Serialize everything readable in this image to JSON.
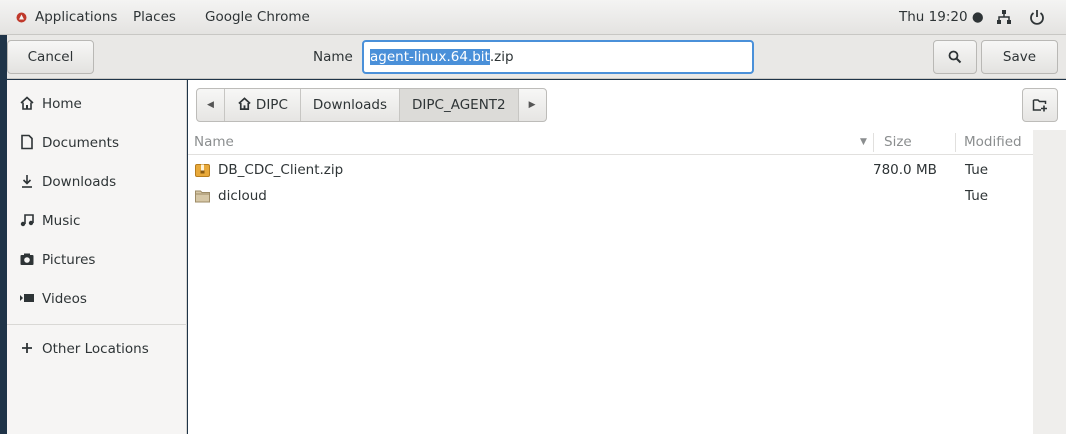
{
  "topbar": {
    "applications": "Applications",
    "places": "Places",
    "active_app": "Google Chrome",
    "clock": "Thu 19:20 ●"
  },
  "dialog": {
    "cancel": "Cancel",
    "name_label": "Name",
    "filename_selected": "agent-linux.64.bit",
    "filename_rest": ".zip",
    "save": "Save"
  },
  "sidebar": {
    "items": [
      {
        "label": "Home",
        "icon": "home-icon"
      },
      {
        "label": "Documents",
        "icon": "document-icon"
      },
      {
        "label": "Downloads",
        "icon": "download-icon"
      },
      {
        "label": "Music",
        "icon": "music-icon"
      },
      {
        "label": "Pictures",
        "icon": "camera-icon"
      },
      {
        "label": "Videos",
        "icon": "video-icon"
      }
    ],
    "other_locations": "Other Locations"
  },
  "pathbar": {
    "crumbs": [
      "DIPC",
      "Downloads",
      "DIPC_AGENT2"
    ],
    "active_crumb": "DIPC_AGENT2"
  },
  "columns": {
    "name": "Name",
    "size": "Size",
    "modified": "Modified"
  },
  "files": [
    {
      "name": "DB_CDC_Client.zip",
      "size": "780.0 MB",
      "modified": "Tue",
      "type": "archive"
    },
    {
      "name": "dicloud",
      "size": "",
      "modified": "Tue",
      "type": "folder"
    }
  ],
  "colors": {
    "accent": "#4a90d9",
    "folder": "#c9b58c",
    "archive": "#e8a93a"
  }
}
